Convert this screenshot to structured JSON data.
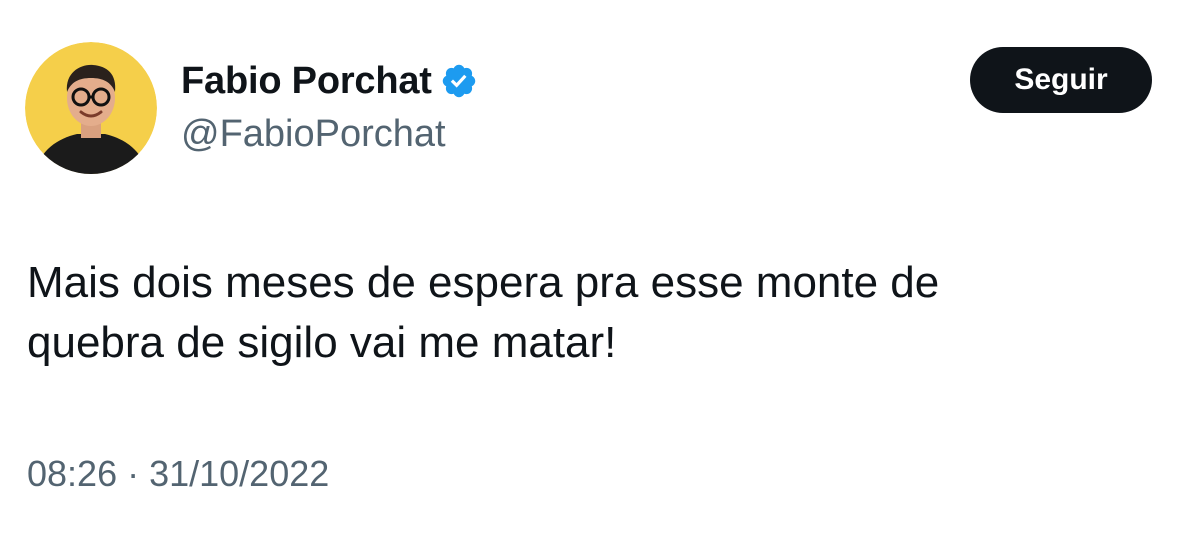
{
  "user": {
    "display_name": "Fabio Porchat",
    "handle": "@FabioPorchat",
    "verified": true,
    "avatar_icon": "profile-photo"
  },
  "follow_button": {
    "label": "Seguir"
  },
  "tweet": {
    "lines": [
      "Mais dois meses de espera pra esse monte de",
      "quebra de sigilo vai me matar!"
    ],
    "time": "08:26",
    "separator": "·",
    "date": "31/10/2022"
  },
  "colors": {
    "text": "#0f1419",
    "secondary": "#536471",
    "verified": "#1d9bf0",
    "button_bg": "#0f1419",
    "avatar_bg": "#f5cf4a"
  }
}
